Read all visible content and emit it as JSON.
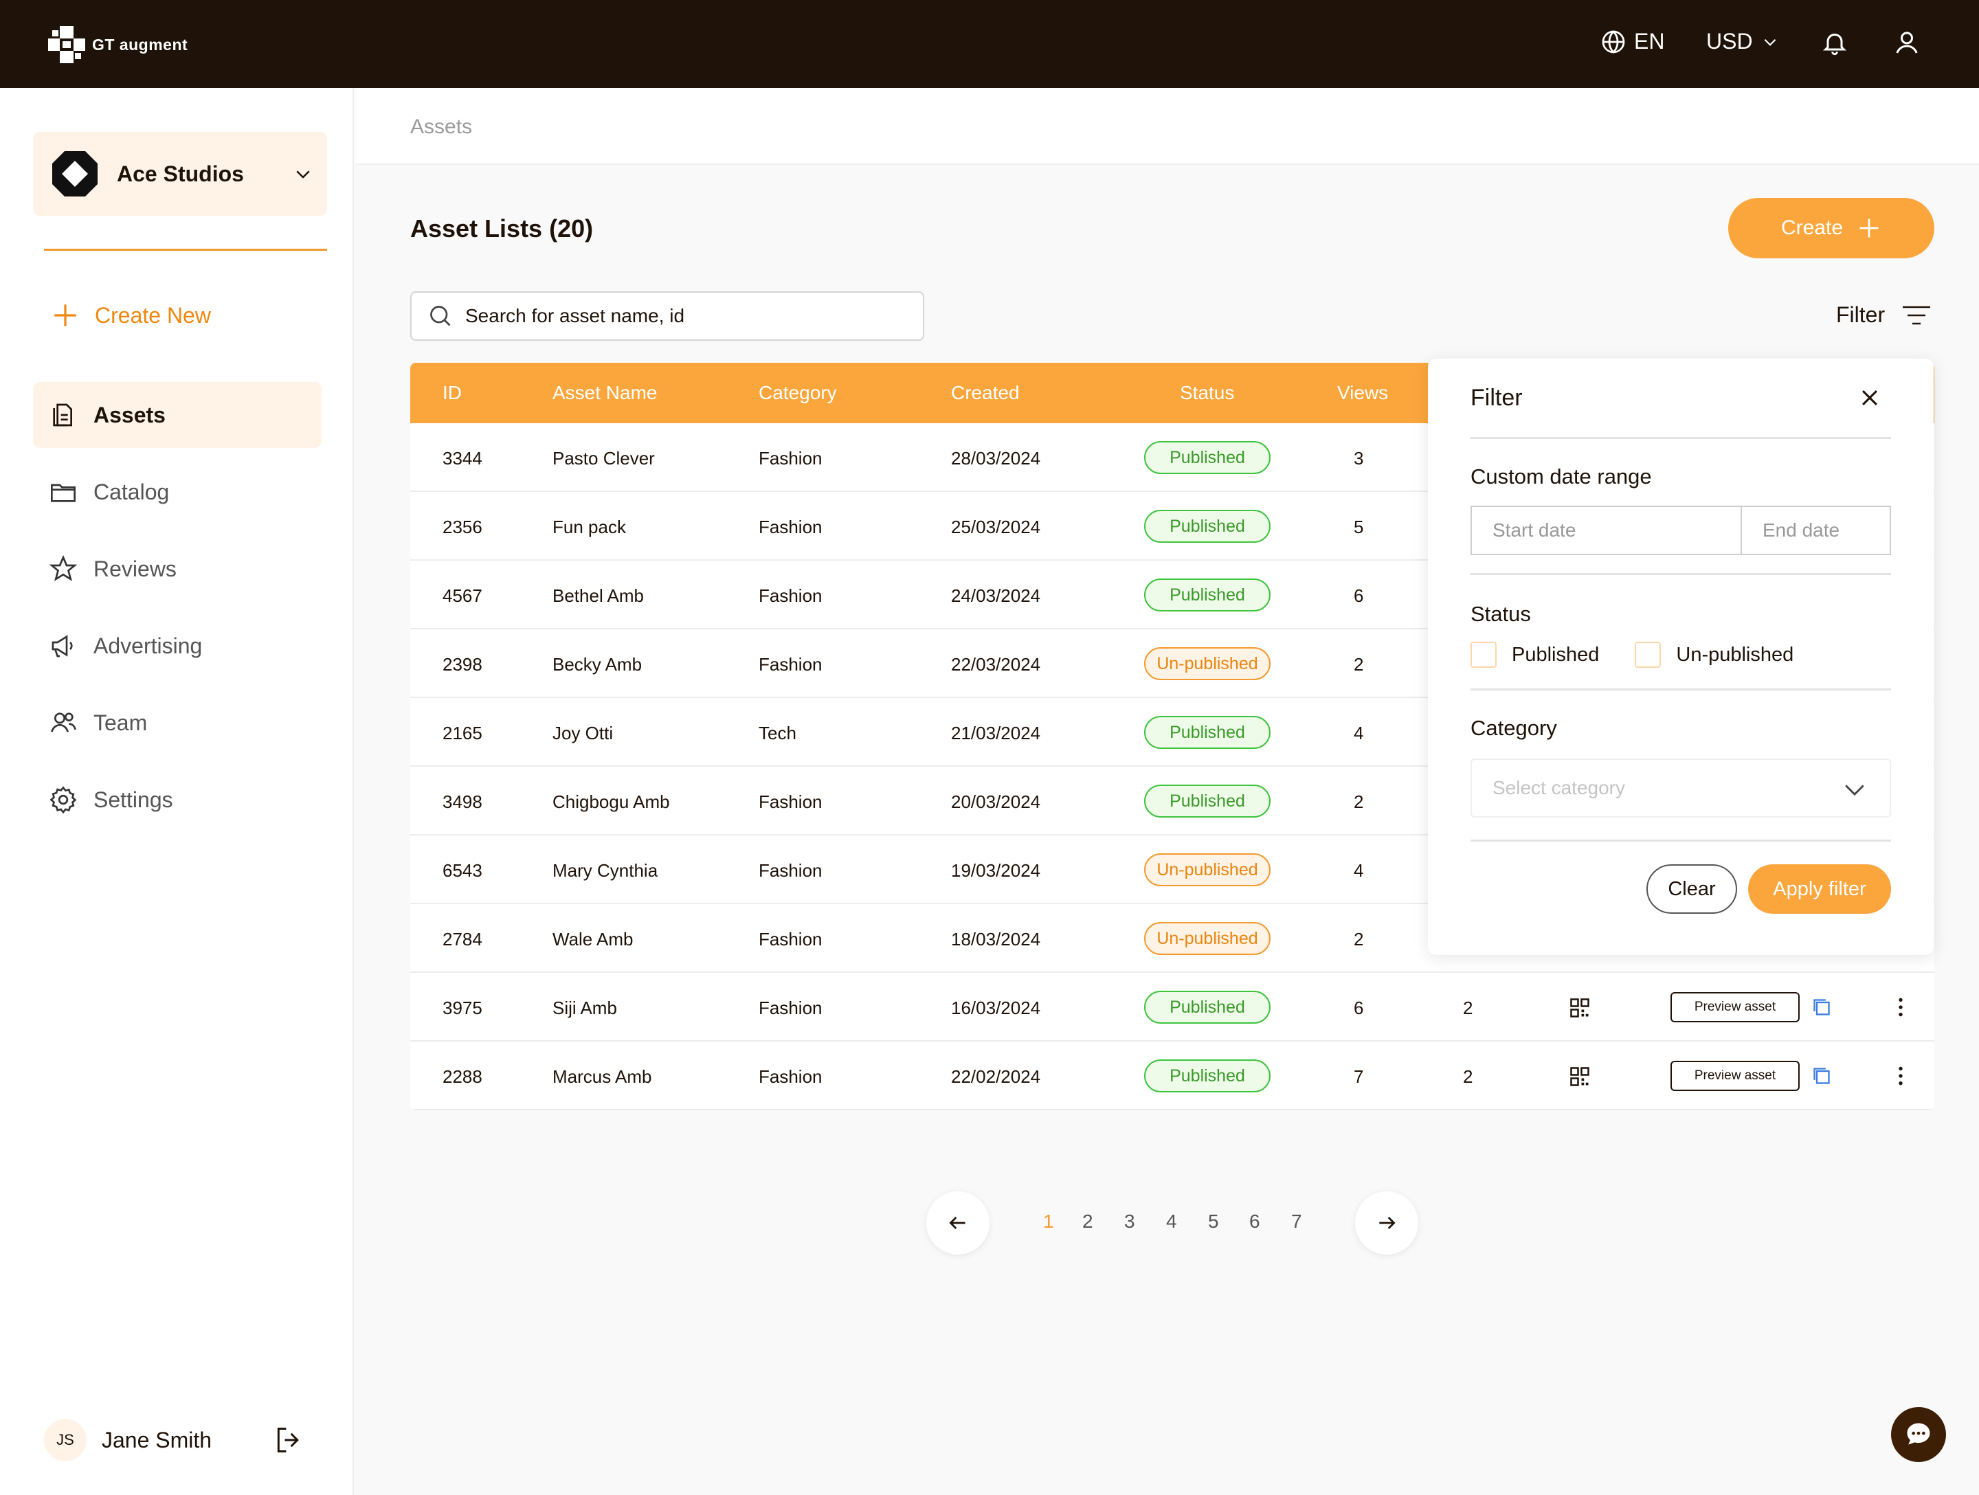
{
  "topbar": {
    "logo_text": "GT augment",
    "language": "EN",
    "currency": "USD"
  },
  "sidebar": {
    "org_name": "Ace Studios",
    "create_new": "Create New",
    "items": [
      {
        "label": "Assets",
        "icon": "document-icon",
        "active": true
      },
      {
        "label": "Catalog",
        "icon": "folder-icon",
        "active": false
      },
      {
        "label": "Reviews",
        "icon": "star-icon",
        "active": false
      },
      {
        "label": "Advertising",
        "icon": "megaphone-icon",
        "active": false
      },
      {
        "label": "Team",
        "icon": "users-icon",
        "active": false
      },
      {
        "label": "Settings",
        "icon": "gear-icon",
        "active": false
      }
    ],
    "user": {
      "initials": "JS",
      "name": "Jane Smith"
    }
  },
  "breadcrumb": "Assets",
  "page_title": "Asset Lists (20)",
  "create_button": "Create",
  "search": {
    "placeholder": "Search for asset name, id"
  },
  "filter_toggle": "Filter",
  "table": {
    "headers": [
      "ID",
      "Asset Name",
      "Category",
      "Created",
      "Status",
      "Views"
    ],
    "rows": [
      {
        "id": "3344",
        "name": "Pasto Clever",
        "category": "Fashion",
        "created": "28/03/2024",
        "status": "Published",
        "views": "3",
        "extra": "",
        "preview": ""
      },
      {
        "id": "2356",
        "name": "Fun pack",
        "category": "Fashion",
        "created": "25/03/2024",
        "status": "Published",
        "views": "5",
        "extra": "",
        "preview": ""
      },
      {
        "id": "4567",
        "name": "Bethel Amb",
        "category": "Fashion",
        "created": "24/03/2024",
        "status": "Published",
        "views": "6",
        "extra": "",
        "preview": ""
      },
      {
        "id": "2398",
        "name": "Becky Amb",
        "category": "Fashion",
        "created": "22/03/2024",
        "status": "Un-published",
        "views": "2",
        "extra": "",
        "preview": ""
      },
      {
        "id": "2165",
        "name": "Joy Otti",
        "category": "Tech",
        "created": "21/03/2024",
        "status": "Published",
        "views": "4",
        "extra": "",
        "preview": ""
      },
      {
        "id": "3498",
        "name": "Chigbogu Amb",
        "category": "Fashion",
        "created": "20/03/2024",
        "status": "Published",
        "views": "2",
        "extra": "",
        "preview": ""
      },
      {
        "id": "6543",
        "name": "Mary Cynthia",
        "category": "Fashion",
        "created": "19/03/2024",
        "status": "Un-published",
        "views": "4",
        "extra": "",
        "preview": ""
      },
      {
        "id": "2784",
        "name": "Wale Amb",
        "category": "Fashion",
        "created": "18/03/2024",
        "status": "Un-published",
        "views": "2",
        "extra": "",
        "preview": ""
      },
      {
        "id": "3975",
        "name": "Siji Amb",
        "category": "Fashion",
        "created": "16/03/2024",
        "status": "Published",
        "views": "6",
        "extra": "2",
        "preview": "Preview asset"
      },
      {
        "id": "2288",
        "name": "Marcus Amb",
        "category": "Fashion",
        "created": "22/02/2024",
        "status": "Published",
        "views": "7",
        "extra": "2",
        "preview": "Preview asset"
      }
    ]
  },
  "filter_panel": {
    "title": "Filter",
    "date_range_label": "Custom date range",
    "start_placeholder": "Start date",
    "end_placeholder": "End date",
    "status_label": "Status",
    "status_options": [
      "Published",
      "Un-published"
    ],
    "category_label": "Category",
    "category_placeholder": "Select category",
    "clear_label": "Clear",
    "apply_label": "Apply filter"
  },
  "pagination": {
    "pages": [
      "1",
      "2",
      "3",
      "4",
      "5",
      "6",
      "7"
    ],
    "current": "1"
  },
  "colors": {
    "topbar_bg": "#1f1208",
    "accent": "#fba63c",
    "published": "#3ec43e",
    "unpublished": "#f59a2e"
  }
}
